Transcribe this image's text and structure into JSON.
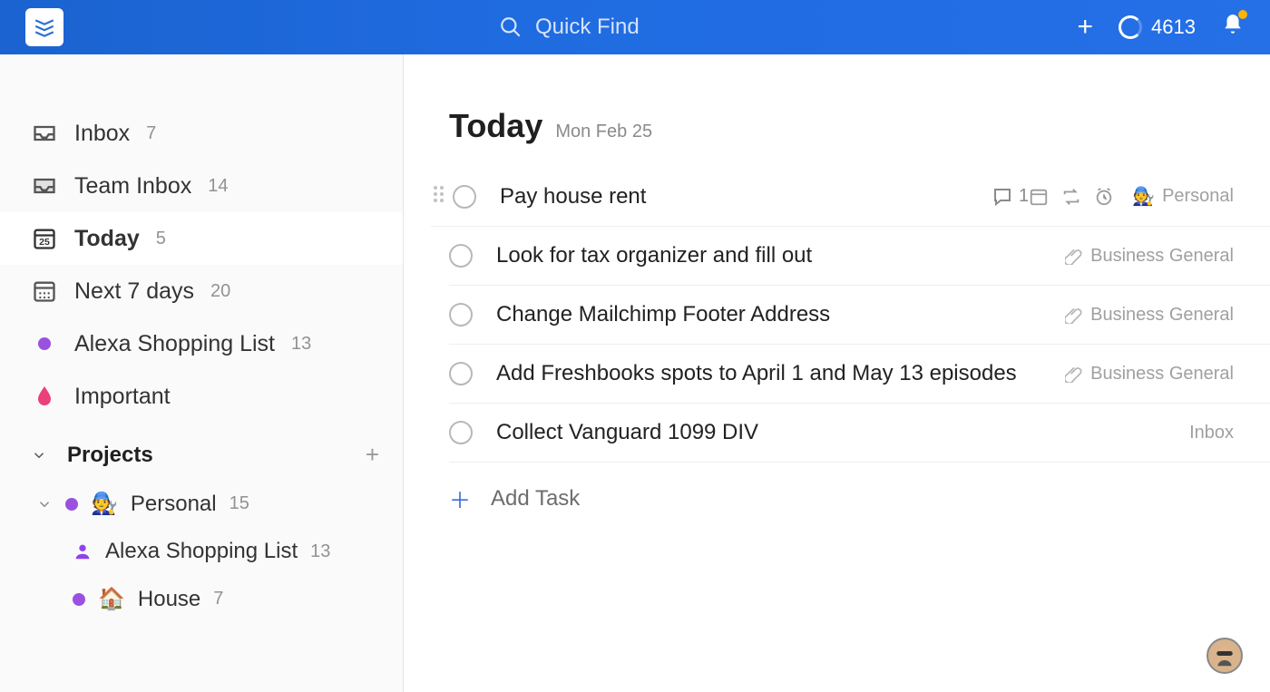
{
  "header": {
    "search_placeholder": "Quick Find",
    "karma_score": "4613"
  },
  "sidebar": {
    "nav": [
      {
        "label": "Inbox",
        "count": "7"
      },
      {
        "label": "Team Inbox",
        "count": "14"
      },
      {
        "label": "Today",
        "count": "5"
      },
      {
        "label": "Next 7 days",
        "count": "20"
      },
      {
        "label": "Alexa Shopping List",
        "count": "13"
      },
      {
        "label": "Important",
        "count": ""
      }
    ],
    "projects_header": "Projects",
    "projects": [
      {
        "label": "Personal",
        "count": "15",
        "emoji": "🧑‍🔧"
      },
      {
        "label": "Alexa Shopping List",
        "count": "13"
      },
      {
        "label": "House",
        "count": "7",
        "emoji": "🏠"
      }
    ]
  },
  "page": {
    "title": "Today",
    "subtitle": "Mon Feb 25",
    "add_task_label": "Add Task"
  },
  "tasks": [
    {
      "title": "Pay house rent",
      "project": "Personal",
      "comments": "1",
      "hover": true
    },
    {
      "title": "Look for tax organizer and fill out",
      "project": "Business General",
      "clip": true
    },
    {
      "title": "Change Mailchimp Footer Address",
      "project": "Business General",
      "clip": true
    },
    {
      "title": "Add Freshbooks spots to April 1 and May 13 episodes",
      "project": "Business General",
      "clip": true
    },
    {
      "title": "Collect Vanguard 1099 DIV",
      "project": "Inbox"
    }
  ]
}
